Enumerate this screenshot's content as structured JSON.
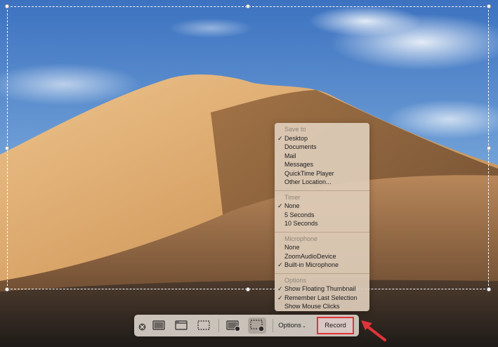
{
  "menu": {
    "sections": [
      {
        "heading": "Save to",
        "items": [
          {
            "label": "Desktop",
            "checked": true
          },
          {
            "label": "Documents",
            "checked": false
          },
          {
            "label": "Mail",
            "checked": false
          },
          {
            "label": "Messages",
            "checked": false
          },
          {
            "label": "QuickTime Player",
            "checked": false
          },
          {
            "label": "Other Location...",
            "checked": false
          }
        ]
      },
      {
        "heading": "Timer",
        "items": [
          {
            "label": "None",
            "checked": true
          },
          {
            "label": "5 Seconds",
            "checked": false
          },
          {
            "label": "10 Seconds",
            "checked": false
          }
        ]
      },
      {
        "heading": "Microphone",
        "items": [
          {
            "label": "None",
            "checked": false
          },
          {
            "label": "ZoomAudioDevice",
            "checked": false
          },
          {
            "label": "Built-in Microphone",
            "checked": true
          }
        ]
      },
      {
        "heading": "Options",
        "items": [
          {
            "label": "Show Floating Thumbnail",
            "checked": true
          },
          {
            "label": "Remember Last Selection",
            "checked": true
          },
          {
            "label": "Show Mouse Clicks",
            "checked": false
          }
        ]
      }
    ],
    "check_glyph": "✓"
  },
  "toolbar": {
    "close_icon": "close-icon",
    "tools": [
      {
        "icon": "capture-entire-screen-icon",
        "selected": false
      },
      {
        "icon": "capture-window-icon",
        "selected": false
      },
      {
        "icon": "capture-selection-icon",
        "selected": false
      },
      {
        "icon": "record-entire-screen-icon",
        "selected": false
      },
      {
        "icon": "record-selection-icon",
        "selected": true
      }
    ],
    "options_label": "Options",
    "options_chevron": "⌄",
    "record_label": "Record"
  },
  "colors": {
    "highlight": "#e0343a",
    "sky_top": "#3f77c4",
    "sky_bottom": "#c6d9ea",
    "dune_light": "#e2b47c",
    "dune_shadow": "#7a5838"
  }
}
